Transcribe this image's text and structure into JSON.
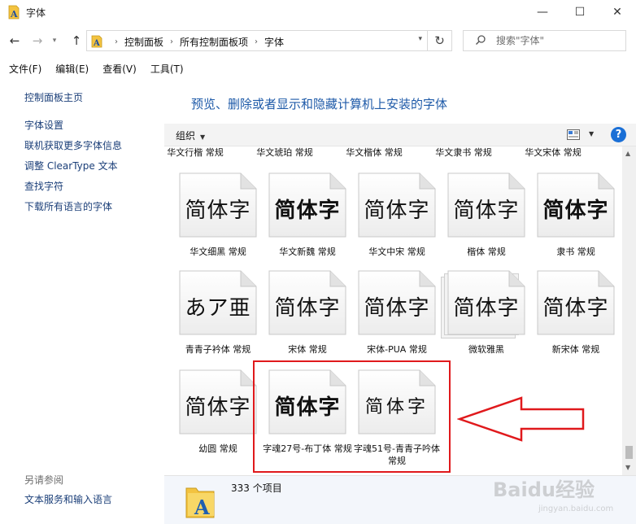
{
  "window": {
    "title": "字体",
    "minimize": "—",
    "maximize": "☐",
    "close": "✕"
  },
  "nav": {
    "back": "←",
    "forward": "→",
    "recent": "▾",
    "up": "↑",
    "breadcrumbs": [
      "控制面板",
      "所有控制面板项",
      "字体"
    ],
    "crumb_sep": "›",
    "address_dropdown": "▾",
    "refresh": "↻",
    "search_placeholder": "搜索\"字体\""
  },
  "menu": [
    "文件(F)",
    "编辑(E)",
    "查看(V)",
    "工具(T)"
  ],
  "left_pane": {
    "home": "控制面板主页",
    "tasks": [
      "字体设置",
      "联机获取更多字体信息",
      "调整 ClearType 文本",
      "查找字符",
      "下载所有语言的字体"
    ],
    "see_also_title": "另请参阅",
    "see_also_link": "文本服务和输入语言"
  },
  "main": {
    "heading": "预览、删除或者显示和隐藏计算机上安装的字体",
    "organize": "组织",
    "organize_caret": "▼",
    "view_caret": "▼",
    "help": "?",
    "top_labels": [
      "华文行楷 常规",
      "华文琥珀 常规",
      "华文楷体 常规",
      "华文隶书 常规",
      "华文宋体 常规"
    ],
    "rows": [
      {
        "tiles": [
          {
            "sample": "简体字",
            "label": "华文细黑 常规",
            "weight": "normal",
            "style": "sans"
          },
          {
            "sample": "简体字",
            "label": "华文新魏 常规",
            "weight": "bold",
            "style": "serif"
          },
          {
            "sample": "简体字",
            "label": "华文中宋 常规",
            "weight": "normal",
            "style": "serif"
          },
          {
            "sample": "简体字",
            "label": "楷体 常规",
            "weight": "normal",
            "style": "serif"
          },
          {
            "sample": "简体字",
            "label": "隶书 常规",
            "weight": "bold",
            "style": "serif"
          }
        ]
      },
      {
        "tiles": [
          {
            "sample": "あア亜",
            "label": "青青子衿体 常规",
            "weight": "normal",
            "style": "serif"
          },
          {
            "sample": "简体字",
            "label": "宋体 常规",
            "weight": "normal",
            "style": "serif"
          },
          {
            "sample": "简体字",
            "label": "宋体-PUA 常规",
            "weight": "normal",
            "style": "serif"
          },
          {
            "sample": "简体字",
            "label": "微软雅黑",
            "weight": "normal",
            "style": "sans",
            "stack": true
          },
          {
            "sample": "简体字",
            "label": "新宋体 常规",
            "weight": "normal",
            "style": "serif"
          }
        ]
      },
      {
        "tiles": [
          {
            "sample": "简体字",
            "label": "幼圆 常规",
            "weight": "normal",
            "style": "sans"
          },
          {
            "sample": "简体字",
            "label": "字魂27号-布丁体 常规",
            "weight": "bold",
            "style": "sans"
          },
          {
            "sample": "简体字",
            "label": "字魂51号-青青子吟体 常规",
            "weight": "normal",
            "style": "serif-light"
          }
        ]
      }
    ]
  },
  "details": {
    "count": "333 个项目"
  },
  "watermark": {
    "text": "Baidu经验",
    "url": "jingyan.baidu.com"
  },
  "colors": {
    "link": "#1a3e78",
    "heading": "#1e5aa8",
    "highlight_red": "#e0191c"
  }
}
